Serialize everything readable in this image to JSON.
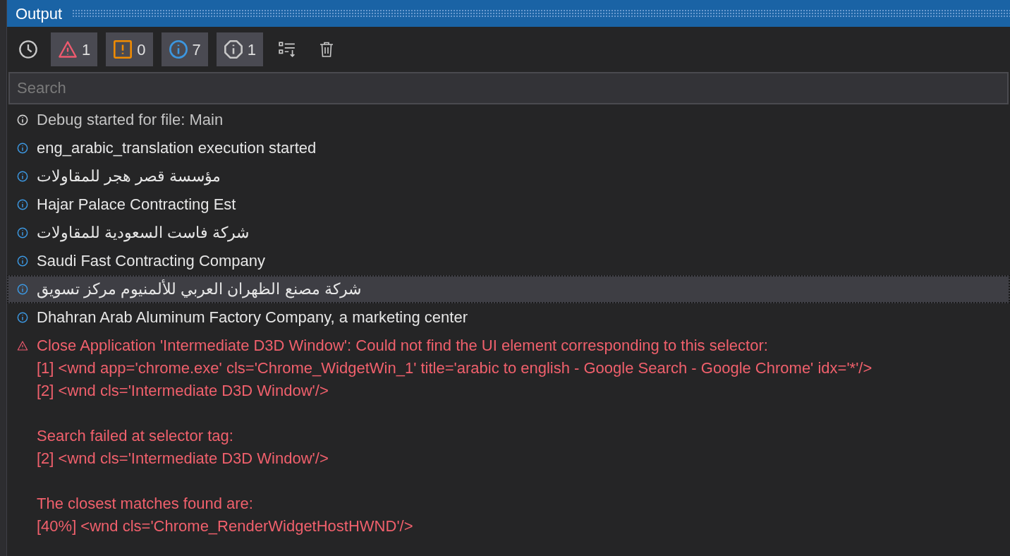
{
  "panel": {
    "title": "Output"
  },
  "filters": [
    {
      "kind": "warning",
      "count": "1",
      "selected": true
    },
    {
      "kind": "error",
      "count": "0",
      "selected": true
    },
    {
      "kind": "info",
      "count": "7",
      "selected": true
    },
    {
      "kind": "trace",
      "count": "1",
      "selected": true
    }
  ],
  "search": {
    "placeholder": "Search"
  },
  "log": [
    {
      "kind": "trace",
      "selected": false,
      "paragraphs": [
        [
          "Debug started for file: Main"
        ]
      ]
    },
    {
      "kind": "info",
      "selected": false,
      "paragraphs": [
        [
          "eng_arabic_translation execution started"
        ]
      ]
    },
    {
      "kind": "info",
      "selected": false,
      "paragraphs": [
        [
          "مؤسسة قصر هجر للمقاولات"
        ]
      ]
    },
    {
      "kind": "info",
      "selected": false,
      "paragraphs": [
        [
          "Hajar Palace Contracting Est"
        ]
      ]
    },
    {
      "kind": "info",
      "selected": false,
      "paragraphs": [
        [
          "شركة فاست السعودية للمقاولات"
        ]
      ]
    },
    {
      "kind": "info",
      "selected": false,
      "paragraphs": [
        [
          "Saudi Fast Contracting Company"
        ]
      ]
    },
    {
      "kind": "info",
      "selected": true,
      "paragraphs": [
        [
          "شركة مصنع الظهران العربي للألمنيوم مركز تسويق"
        ]
      ]
    },
    {
      "kind": "info",
      "selected": false,
      "paragraphs": [
        [
          "Dhahran Arab Aluminum Factory Company, a marketing center"
        ]
      ]
    },
    {
      "kind": "warning",
      "selected": false,
      "paragraphs": [
        [
          "Close Application 'Intermediate D3D Window': Could not find the UI element corresponding to this selector:",
          "[1] <wnd app='chrome.exe' cls='Chrome_WidgetWin_1' title='arabic to english - Google Search - Google Chrome' idx='*'/>",
          "[2] <wnd cls='Intermediate D3D Window'/>"
        ],
        [
          "Search failed at selector tag:",
          "[2] <wnd cls='Intermediate D3D Window'/>"
        ],
        [
          "The closest matches found are:",
          "[40%] <wnd cls='Chrome_RenderWidgetHostHWND'/>"
        ]
      ]
    }
  ]
}
